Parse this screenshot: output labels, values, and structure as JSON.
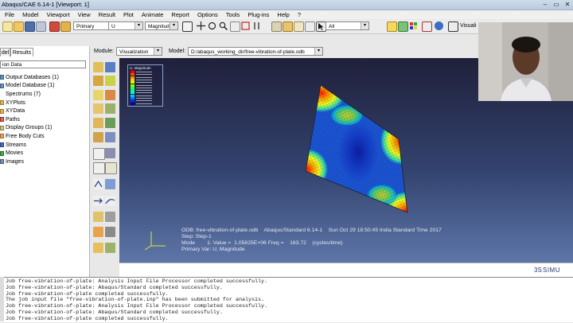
{
  "window": {
    "title": "Abaqus/CAE 6.14-1 [Viewport: 1]"
  },
  "menu": [
    "File",
    "Model",
    "Viewport",
    "View",
    "Result",
    "Plot",
    "Animate",
    "Report",
    "Options",
    "Tools",
    "Plug-ins",
    "Help",
    "?"
  ],
  "toolbar": {
    "step_selector": "Primary",
    "variable_selector": "U",
    "component_selector": "Magnitude",
    "selection_filter": "All",
    "visualization_label": "Visuali"
  },
  "context": {
    "module_label": "Module:",
    "module_value": "Visualization",
    "model_label": "Model:",
    "model_value": "D:/abaqus_working_dir/free-vibration-of-plate.odb"
  },
  "tabs": [
    "del",
    "Results"
  ],
  "session": {
    "dropdown": "ion Data"
  },
  "tree": [
    "Output Databases (1)",
    "Model Database (1)",
    "Spectrums (7)",
    "XYPlots",
    "XYData",
    "Paths",
    "Display Groups (1)",
    "Free Body Cuts",
    "Streams",
    "Movies",
    "Images"
  ],
  "legend": {
    "title": "U, Magnitude",
    "colors": [
      "#ff0000",
      "#ff4a00",
      "#ff9100",
      "#ffd000",
      "#d8ff00",
      "#8cff00",
      "#3cff30",
      "#00ff8a",
      "#00ffd8",
      "#00c8ff",
      "#007aff",
      "#0030ff",
      "#0000c0"
    ]
  },
  "viewport_info": {
    "line1": "ODB: free-vibration-of-plate.odb    Abaqus/Standard 6.14-1    Sun Oct 29 18:50:45 India Standard Time 2017",
    "line2": "Step: Step-1",
    "line3": "Mode        1: Value =  1.05825E+06 Freq =    163.72    (cycles/time)",
    "line4": "Primary Var: U, Magnitude"
  },
  "brand": "SIMU",
  "log": [
    "Job free-vibration-of-plate: Analysis Input File Processor completed successfully.",
    "Job free-vibration-of-plate: Abaqus/Standard completed successfully.",
    "Job free-vibration-of-plate completed successfully.",
    "The job input file \"free-vibration-of-plate.inp\" has been submitted for analysis.",
    "Job free-vibration-of-plate: Analysis Input File Processor completed successfully.",
    "Job free-vibration-of-plate: Abaqus/Standard completed successfully.",
    "Job free-vibration-of-plate completed successfully."
  ]
}
